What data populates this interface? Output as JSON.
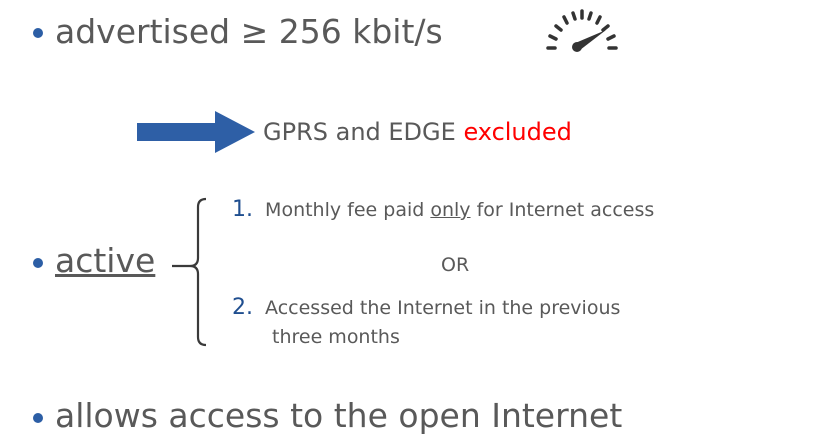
{
  "item1": {
    "text": "advertised ≥ 256 kbit/s",
    "icon": "speedometer-icon"
  },
  "arrow_note": {
    "prefix": "GPRS and EDGE",
    "highlight": "excluded",
    "highlight_color": "#ff0000"
  },
  "item2": {
    "label": "active",
    "option1_num": "1.",
    "option1_pre": "Monthly fee paid ",
    "option1_underlined": "only",
    "option1_post": " for Internet access",
    "or_text": "OR",
    "option2_num": "2.",
    "option2_line1": "Accessed the Internet in the previous",
    "option2_line2": "three months"
  },
  "item3": {
    "text": "allows access to the open Internet"
  },
  "colors": {
    "bullet": "#2c5ea5",
    "arrow": "#2e5fa6",
    "text": "#595959",
    "number": "#1f4e8f"
  }
}
